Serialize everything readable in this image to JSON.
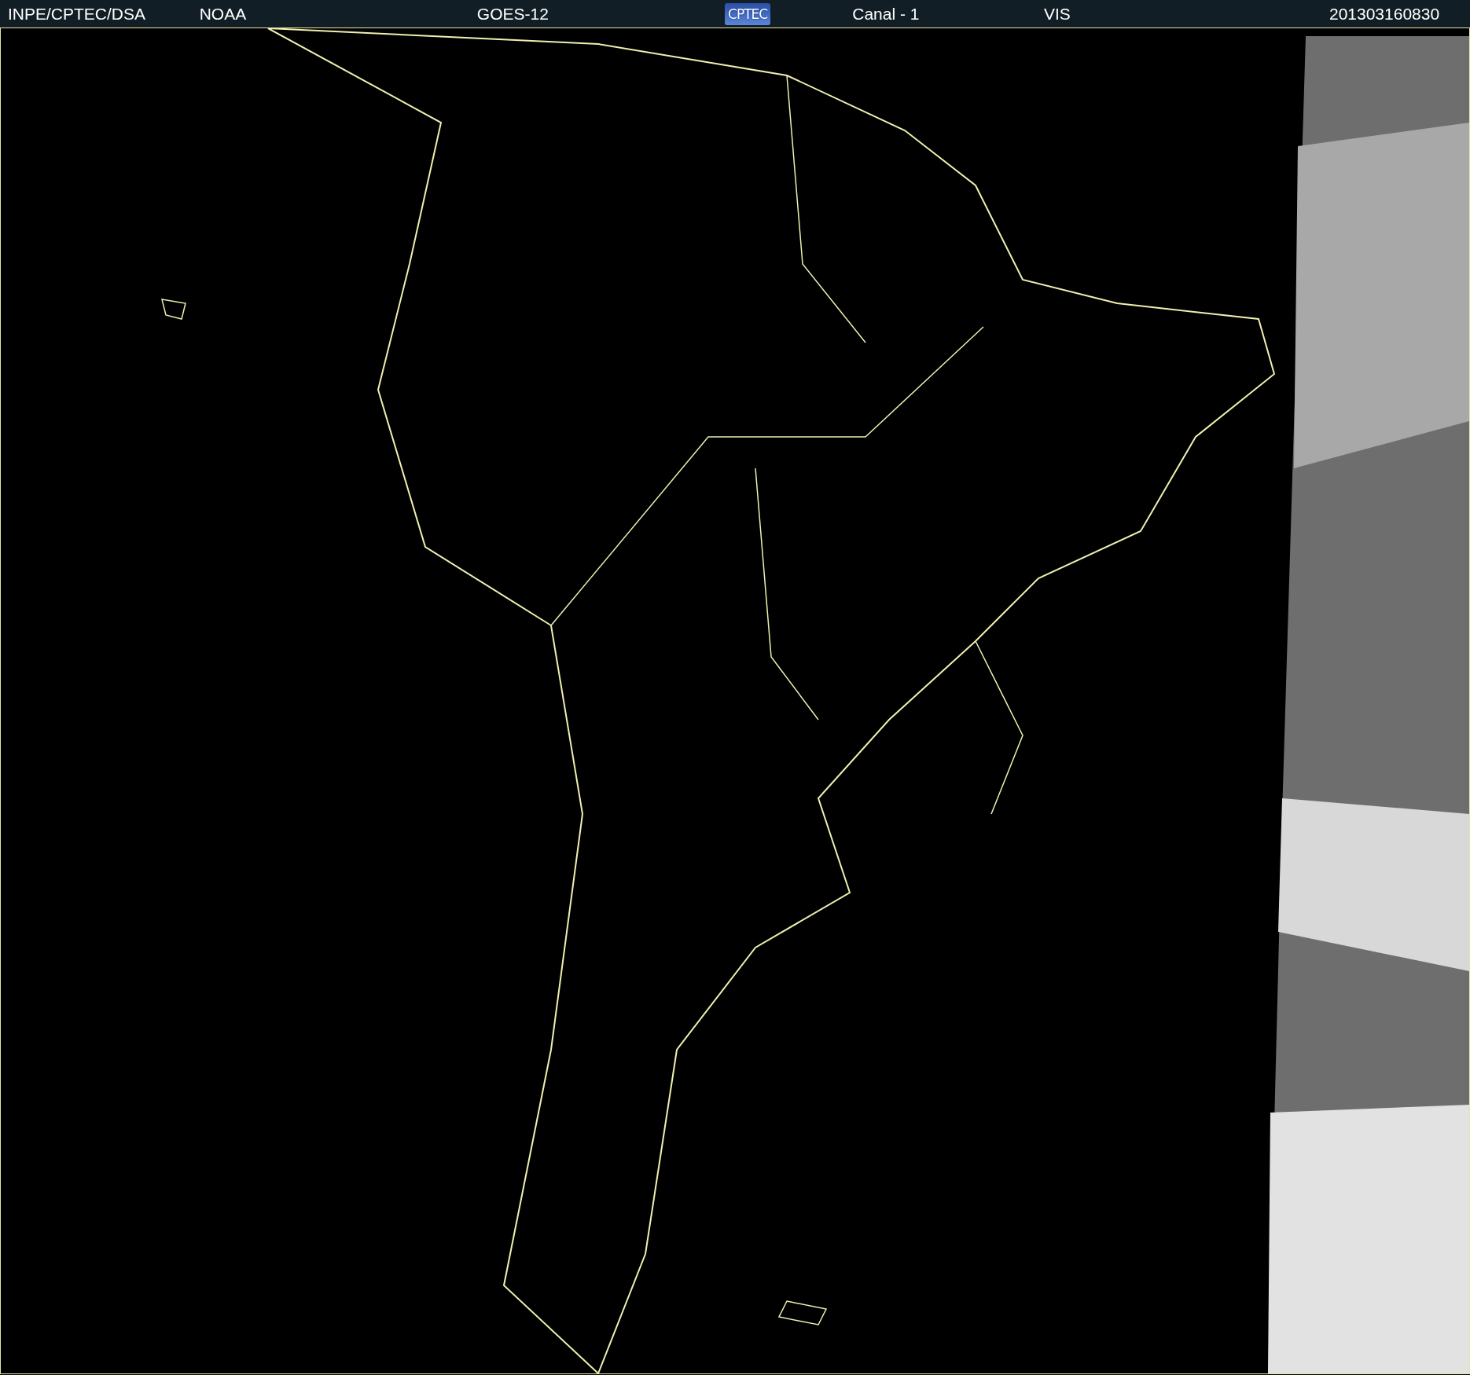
{
  "header": {
    "items": [
      {
        "kind": "text",
        "text": "INPE/CPTEC/DSA"
      },
      {
        "kind": "text",
        "text": "NOAA"
      },
      {
        "kind": "text",
        "text": "GOES-12"
      },
      {
        "kind": "logo",
        "text": "CPTEC"
      },
      {
        "kind": "text",
        "text": "Canal - 1"
      },
      {
        "kind": "text",
        "text": "VIS"
      },
      {
        "kind": "text",
        "text": "201303160830"
      }
    ]
  }
}
